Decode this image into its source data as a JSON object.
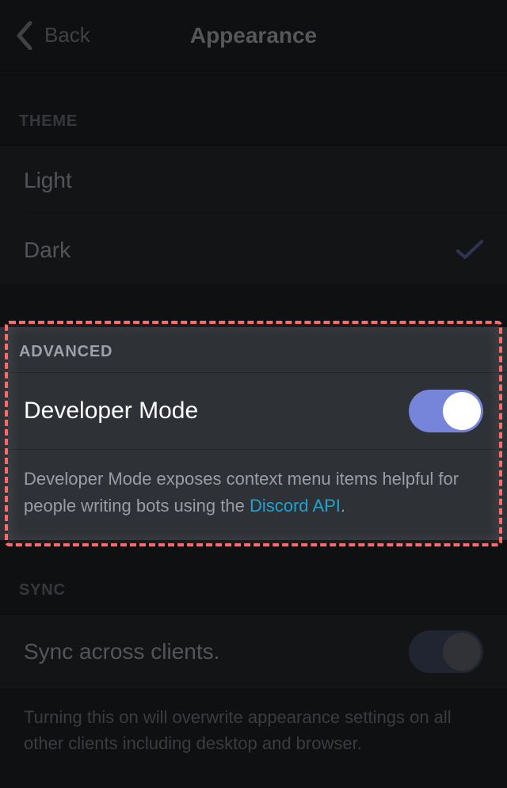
{
  "header": {
    "back_label": "Back",
    "title": "Appearance"
  },
  "theme": {
    "section_label": "THEME",
    "options": {
      "light": "Light",
      "dark": "Dark"
    },
    "selected": "dark"
  },
  "advanced": {
    "section_label": "ADVANCED",
    "developer_mode_label": "Developer Mode",
    "developer_mode_on": true,
    "description_prefix": "Developer Mode exposes context menu items helpful for people writing bots using the ",
    "description_link_text": "Discord API",
    "description_suffix": "."
  },
  "sync": {
    "section_label": "SYNC",
    "row_label": "Sync across clients.",
    "sync_on": false,
    "description": "Turning this on will overwrite appearance settings on all other clients including desktop and browser."
  },
  "colors": {
    "accent_link": "#1fa4d1",
    "switch_on": "#7684d9",
    "highlight_border": "#ff6b6b"
  },
  "annotation": {
    "highlighted_section": "advanced"
  }
}
